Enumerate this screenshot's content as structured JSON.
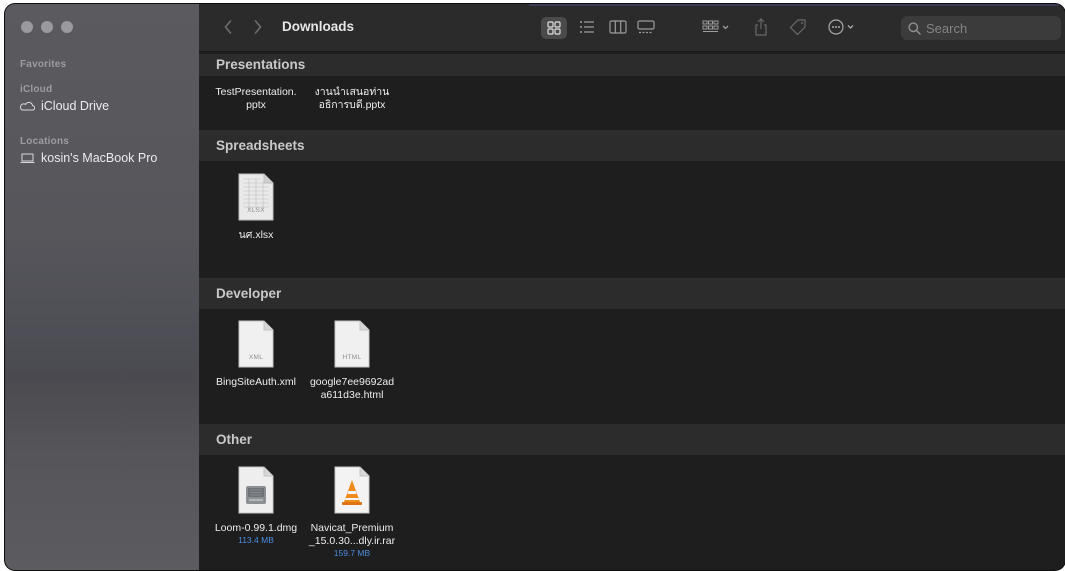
{
  "window": {
    "title": "Downloads"
  },
  "sidebar": {
    "sections": [
      {
        "label": "Favorites"
      },
      {
        "label": "iCloud",
        "items": [
          {
            "label": "iCloud Drive",
            "icon": "cloud-icon"
          }
        ]
      },
      {
        "label": "Locations",
        "items": [
          {
            "label": "kosin's MacBook Pro",
            "icon": "laptop-icon"
          }
        ]
      }
    ]
  },
  "toolbar": {
    "back_icon": "chevron-left-icon",
    "forward_icon": "chevron-right-icon",
    "views": [
      "icon-view",
      "list-view",
      "column-view",
      "gallery-view"
    ],
    "active_view": "icon-view",
    "search": {
      "placeholder": "Search",
      "value": ""
    }
  },
  "groups": [
    {
      "title": "Presentations",
      "files": [
        {
          "name": "TestPresentation.\npptx"
        },
        {
          "name": "งานนำเสนอท่าน\nอธิการบดี.pptx"
        }
      ]
    },
    {
      "title": "Spreadsheets",
      "files": [
        {
          "name": "นศ.xlsx",
          "type": "XLSX"
        }
      ]
    },
    {
      "title": "Developer",
      "files": [
        {
          "name": "BingSiteAuth.xml",
          "type": "XML"
        },
        {
          "name": "google7ee9692ad\na611d3e.html",
          "type": "HTML"
        }
      ]
    },
    {
      "title": "Other",
      "files": [
        {
          "name": "Loom-0.99.1.dmg",
          "size": "113.4 MB",
          "icon": "disk-image-icon"
        },
        {
          "name": "Navicat_Premium\n_15.0.30...dly.ir.rar",
          "size": "159.7 MB",
          "icon": "vlc-cone-icon"
        }
      ]
    }
  ],
  "colors": {
    "accent": "#4a8de0",
    "window_bg": "#1e1e1e",
    "sidebar_bg": "#56565b"
  }
}
